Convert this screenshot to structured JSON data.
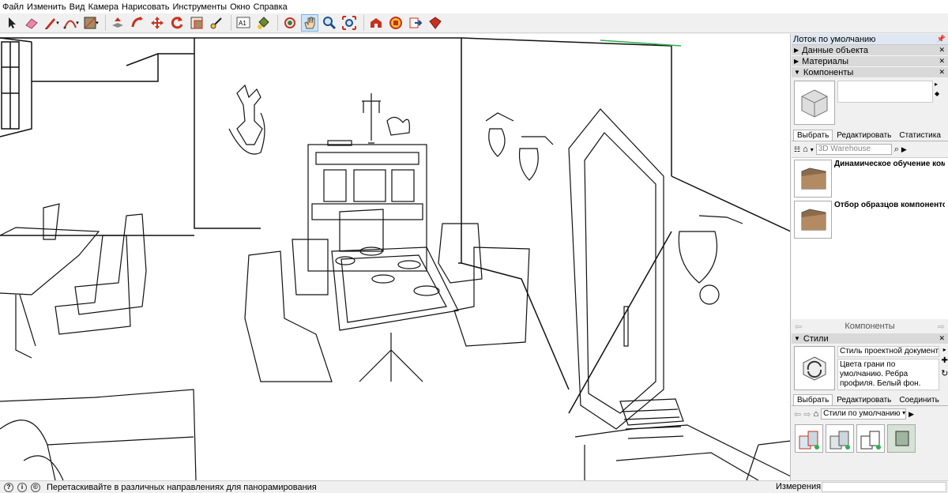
{
  "menu": [
    "Файл",
    "Изменить",
    "Вид",
    "Камера",
    "Нарисовать",
    "Инструменты",
    "Окно",
    "Справка"
  ],
  "toolbar": {
    "tools": [
      "select-tool",
      "eraser-tool",
      "pencil-tool",
      "arc-tool",
      "rectangle-tool",
      "push-pull-tool",
      "move-tool",
      "rotate-tool",
      "follow-me-tool",
      "scale-tool",
      "offset-tool",
      "tape-measure-tool",
      "text-tool",
      "paint-bucket-tool",
      "orbit-tool",
      "pan-tool",
      "zoom-tool",
      "zoom-extents-tool",
      "warehouse-tool",
      "extension-tool",
      "share-tool",
      "ruby-tool"
    ],
    "text_label": "A1",
    "active": "pan-tool"
  },
  "tray": {
    "title": "Лоток по умолчанию",
    "sections": {
      "entity_info": "Данные объекта",
      "materials": "Материалы",
      "components": "Компоненты",
      "styles": "Стили"
    }
  },
  "components": {
    "tabs": [
      "Выбрать",
      "Редактировать",
      "Статистика"
    ],
    "search_placeholder": "3D Warehouse",
    "items": [
      {
        "title": "Динамическое обучение ком..."
      },
      {
        "title": "Отбор образцов компонентов"
      }
    ],
    "footer": "Компоненты"
  },
  "styles": {
    "name": "Стиль проектной документ",
    "description": "Цвета грани по умолчанию. Ребра профиля. Белый фон.",
    "tabs": [
      "Выбрать",
      "Редактировать",
      "Соединить"
    ],
    "dropdown": "Стили по умолчанию"
  },
  "status": {
    "text": "Перетаскивайте в различных направлениях для панорамирования",
    "measurements_label": "Измерения",
    "measurements_value": ""
  },
  "colors": {
    "accent": "#cce4f7",
    "tray_header": "#dfe8f2",
    "section": "#d9d9d9",
    "green_axis": "#2bb24c"
  }
}
